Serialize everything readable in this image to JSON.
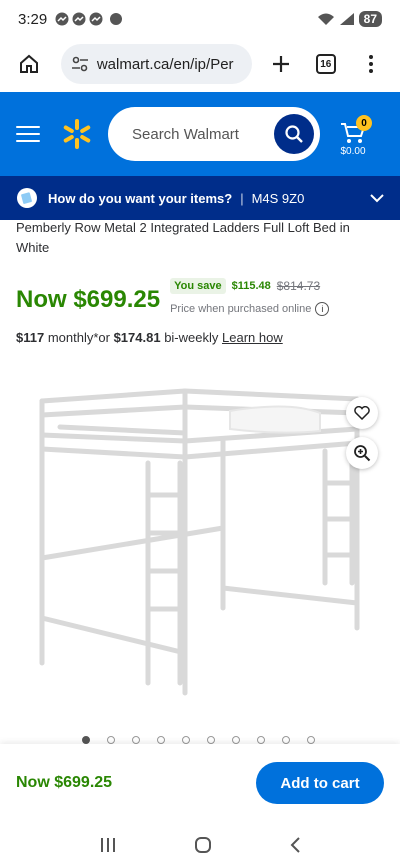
{
  "status": {
    "time": "3:29",
    "battery": "87"
  },
  "browser": {
    "url": "walmart.ca/en/ip/Per",
    "tab_count": "16"
  },
  "header": {
    "search_placeholder": "Search Walmart",
    "cart_badge": "0",
    "cart_total": "$0.00"
  },
  "delivery": {
    "question": "How do you want your items?",
    "separator": "|",
    "postal_code": "M4S 9Z0"
  },
  "product": {
    "title": "Pemberly Row Metal 2 Integrated Ladders Full Loft Bed in White",
    "now_price": "Now $699.25",
    "you_save_label": "You save",
    "save_amount": "$115.48",
    "was_price": "$814.73",
    "price_note": "Price when purchased online",
    "monthly_amount": "$117",
    "monthly_text": " monthly*or ",
    "biweekly_amount": "$174.81",
    "biweekly_text": " bi-weekly ",
    "learn_how": "Learn how"
  },
  "carousel": {
    "dots": 10,
    "active": 0
  },
  "sticky": {
    "price": "Now $699.25",
    "add_to_cart": "Add to cart"
  },
  "colors": {
    "walmart_blue": "#0071dc",
    "dark_blue": "#002d8a",
    "spark_yellow": "#ffc220",
    "price_green": "#2a8703"
  }
}
